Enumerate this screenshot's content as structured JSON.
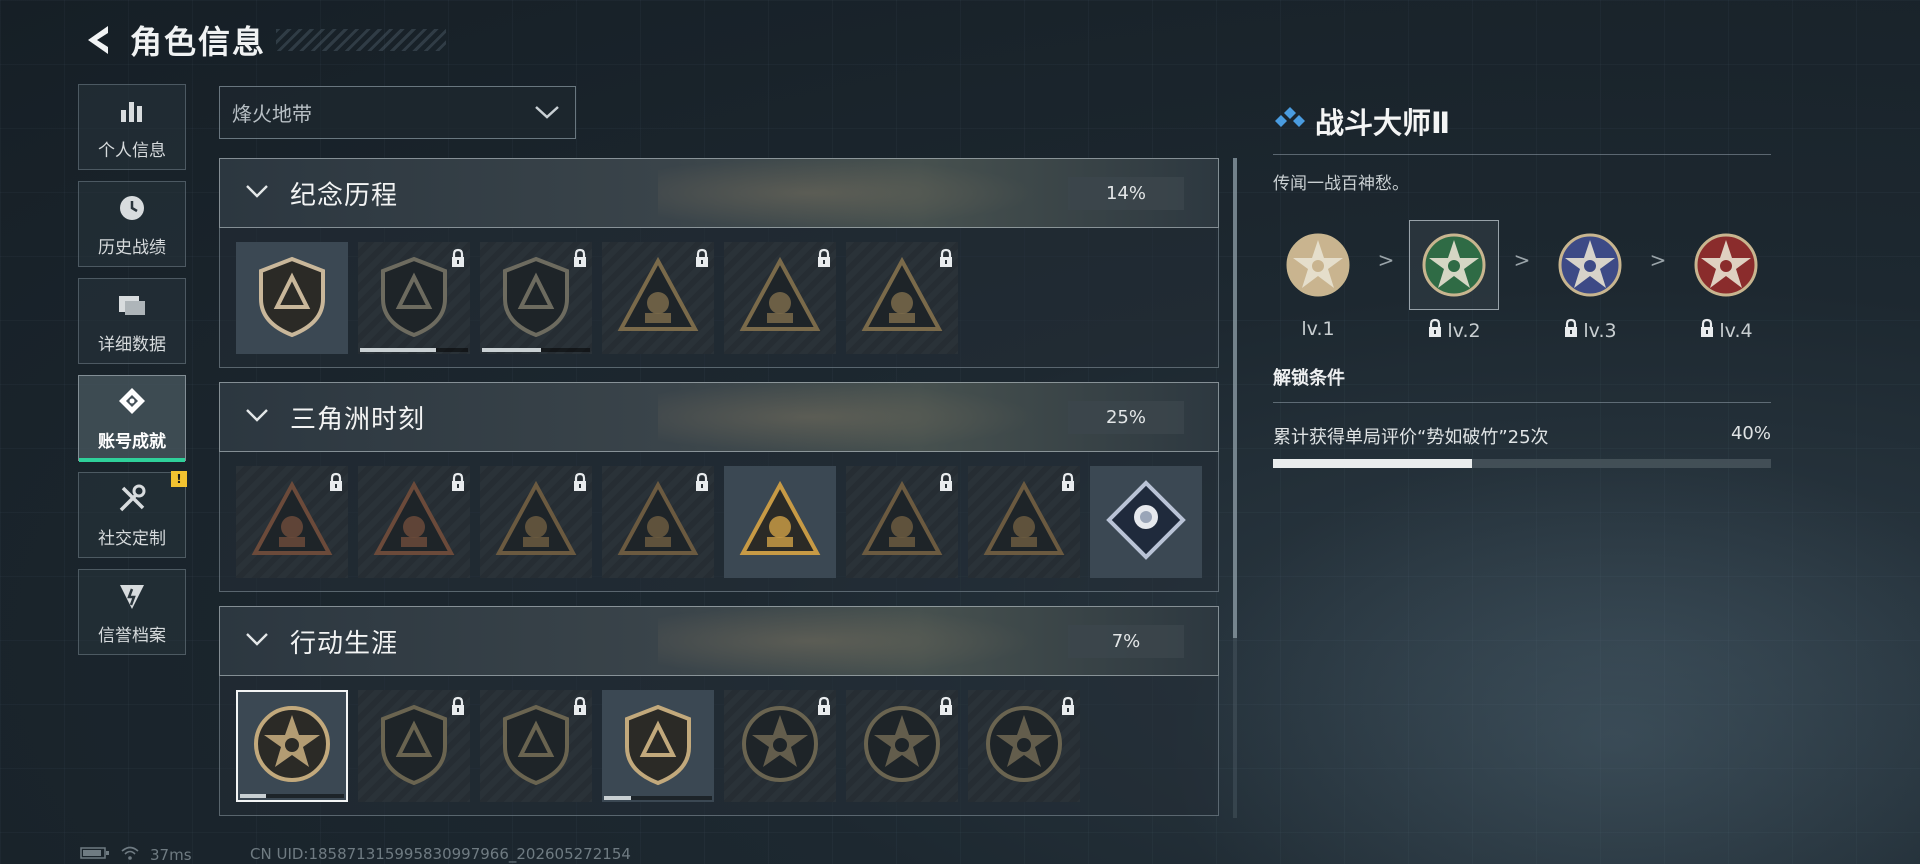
{
  "header": {
    "title": "角色信息"
  },
  "sidebar": {
    "items": [
      {
        "label": "个人信息",
        "icon": "bar-chart-icon",
        "active": false
      },
      {
        "label": "历史战绩",
        "icon": "clock-icon",
        "active": false
      },
      {
        "label": "详细数据",
        "icon": "folder-icon",
        "active": false
      },
      {
        "label": "账号成就",
        "icon": "achievement-icon",
        "active": true
      },
      {
        "label": "社交定制",
        "icon": "tools-icon",
        "active": false,
        "badge": "!"
      },
      {
        "label": "信誉档案",
        "icon": "reputation-icon",
        "active": false
      }
    ]
  },
  "mode_select": {
    "value": "烽火地带"
  },
  "categories": [
    {
      "title": "纪念历程",
      "percent": "14%",
      "badges": [
        {
          "shape": "shield",
          "locked": false,
          "color": "#c9b79a",
          "progress": 0.0
        },
        {
          "shape": "shield",
          "locked": true,
          "color": "#6d6b5f",
          "progress": 0.7
        },
        {
          "shape": "shield",
          "locked": true,
          "color": "#6d6b5f",
          "progress": 0.55
        },
        {
          "shape": "triangle",
          "locked": true,
          "color": "#7a6a4a"
        },
        {
          "shape": "triangle",
          "locked": true,
          "color": "#7a6a4a"
        },
        {
          "shape": "triangle",
          "locked": true,
          "color": "#7a6a4a"
        }
      ]
    },
    {
      "title": "三角洲时刻",
      "percent": "25%",
      "badges": [
        {
          "shape": "triangle",
          "locked": true,
          "color": "#6b4a3a"
        },
        {
          "shape": "triangle",
          "locked": true,
          "color": "#6b4a3a"
        },
        {
          "shape": "triangle",
          "locked": true,
          "color": "#6b5a40"
        },
        {
          "shape": "triangle",
          "locked": true,
          "color": "#6b5a40"
        },
        {
          "shape": "triangle",
          "locked": false,
          "color": "#c79a45"
        },
        {
          "shape": "triangle",
          "locked": true,
          "color": "#6b5a40"
        },
        {
          "shape": "triangle",
          "locked": true,
          "color": "#6b5a40"
        },
        {
          "shape": "diamond",
          "locked": false,
          "color": "#b9c3d6"
        }
      ]
    },
    {
      "title": "行动生涯",
      "percent": "7%",
      "badges": [
        {
          "shape": "circle",
          "locked": false,
          "selected": true,
          "color": "#c2a97c",
          "progress": 0.25
        },
        {
          "shape": "shield",
          "locked": true,
          "color": "#6a6450"
        },
        {
          "shape": "shield",
          "locked": true,
          "color": "#6a6450"
        },
        {
          "shape": "shield",
          "locked": false,
          "color": "#c2a97c",
          "progress": 0.25
        },
        {
          "shape": "circle",
          "locked": true,
          "color": "#6a6450"
        },
        {
          "shape": "circle",
          "locked": true,
          "color": "#6a6450"
        },
        {
          "shape": "circle",
          "locked": true,
          "color": "#6a6450"
        }
      ]
    }
  ],
  "detail": {
    "title": "战斗大师Ⅱ",
    "description": "传闻一战百神愁。",
    "levels": [
      {
        "label": "lv.1",
        "locked": false,
        "current": false,
        "color": "#c9b48f"
      },
      {
        "label": "lv.2",
        "locked": true,
        "current": true,
        "color": "#2f6b45"
      },
      {
        "label": "lv.3",
        "locked": true,
        "current": false,
        "color": "#3d4a86"
      },
      {
        "label": "lv.4",
        "locked": true,
        "current": false,
        "color": "#8a2c2c"
      }
    ],
    "separator": ">",
    "condition_title": "解锁条件",
    "condition_text": "累计获得单局评价“势如破竹”25次",
    "condition_percent": "40%",
    "condition_progress": 0.4
  },
  "status": {
    "ping": "37ms",
    "uid": "CN UID:18587131599583099​7966_202605272154"
  }
}
